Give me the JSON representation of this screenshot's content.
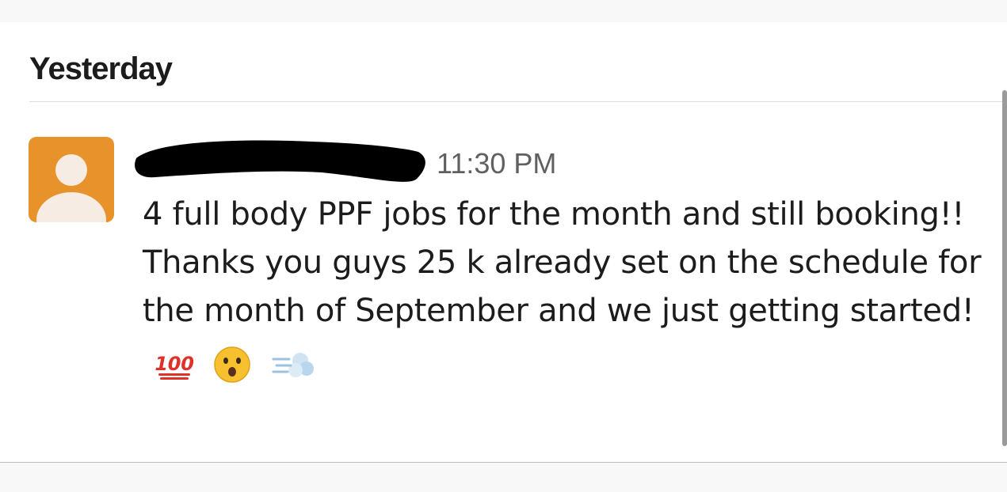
{
  "day_header": "Yesterday",
  "message": {
    "timestamp": "11:30 PM",
    "text": "4 full body PPF jobs for the month and still booking!! Thanks you guys 25 k already set on the schedule for the month of September and we just getting started!",
    "emojis": [
      "hundred-points-icon",
      "astonished-face-icon",
      "dash-symbol-icon"
    ]
  },
  "colors": {
    "avatar_background": "#e8922c",
    "avatar_foreground": "#f6ece3",
    "text_primary": "#1d1c1d",
    "text_secondary": "#616061"
  }
}
